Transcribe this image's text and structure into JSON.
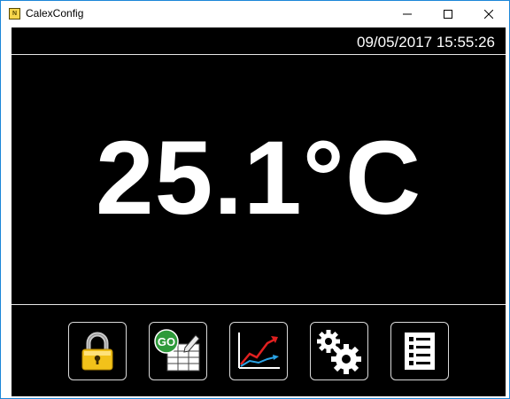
{
  "window": {
    "title": "CalexConfig",
    "icon": "calex-app-icon",
    "icon_glyph": "N",
    "controls": [
      "minimize-icon",
      "maximize-icon",
      "close-icon"
    ]
  },
  "status": {
    "datetime": "09/05/2017 15:55:26"
  },
  "reading": {
    "value": "25.1",
    "unit": "°C"
  },
  "toolbar": {
    "buttons": [
      {
        "id": "lock",
        "icon": "padlock-icon"
      },
      {
        "id": "go",
        "icon": "go-spreadsheet-icon",
        "badge": "GO"
      },
      {
        "id": "chart",
        "icon": "trend-chart-icon"
      },
      {
        "id": "settings",
        "icon": "gears-icon"
      },
      {
        "id": "list",
        "icon": "list-icon"
      }
    ]
  },
  "colors": {
    "window_border": "#1c86d8",
    "screen_bg": "#000000",
    "text": "#ffffff",
    "go_badge": "#2e9a3a",
    "lock_body": "#f2c21a",
    "chart_up": "#e02020",
    "chart_low": "#2aa3e6"
  }
}
